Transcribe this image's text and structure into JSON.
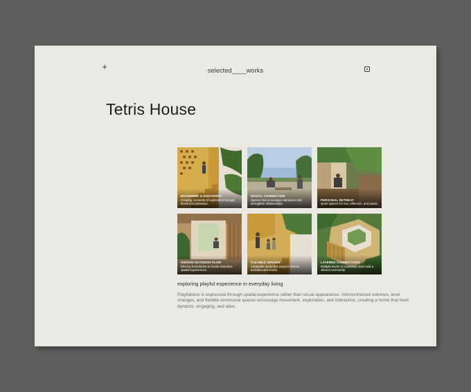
{
  "header": {
    "menu_symbol": "+",
    "brand": "selected____works",
    "social_icon": "instagram-icon"
  },
  "project": {
    "title": "Tetris House",
    "subheading": "exploring playful experience in everyday living",
    "description": "Playfulness is expressed through spatial experience rather than visual appearance. Interconnected volumes, level changes, and flexible communal spaces encourage movement, exploration, and interaction, creating a home that feels dynamic, engaging, and alive."
  },
  "gallery": [
    {
      "title": "MOVEMENT & DISCOVERY",
      "caption": "Creating moments of exploration through levels and pathways."
    },
    {
      "title": "SOCIAL CONNECTION",
      "caption": "Spaces that encourage interaction and strengthen relationships."
    },
    {
      "title": "PERSONAL RETREAT",
      "caption": "Quiet spaces for rest, reflection, and pause."
    },
    {
      "title": "INDOOR-OUTDOOR FLOW",
      "caption": "Blurring boundaries to create seamless spatial experiences."
    },
    {
      "title": "FLEXIBLE SPACES",
      "caption": "Adaptable areas that support diverse activities and needs."
    },
    {
      "title": "LAYERED CONNECTIONS",
      "caption": "Multiple levels of connection that build a vibrant community."
    }
  ],
  "colors": {
    "background": "#5f5f5f",
    "card": "#ebe9e4",
    "text": "#1d1d1d",
    "muted_text": "#6a6a6a"
  }
}
